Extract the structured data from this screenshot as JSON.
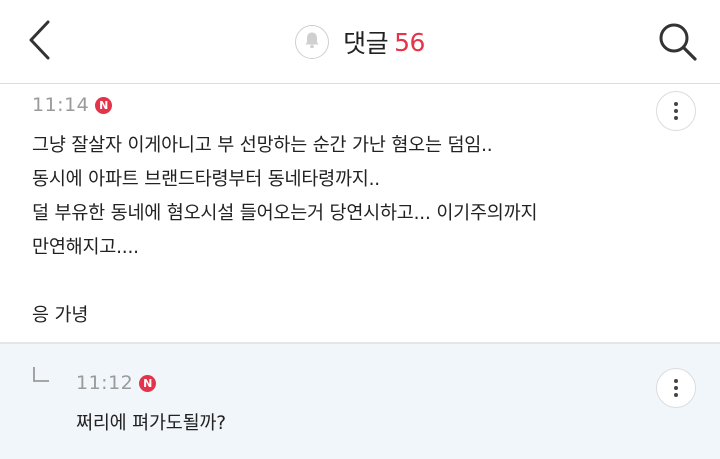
{
  "header": {
    "title": "댓글",
    "count": "56",
    "back_icon": "chevron-left-icon",
    "bell_icon": "bell-icon",
    "search_icon": "search-icon",
    "accent_color": "#e5334b"
  },
  "comments": [
    {
      "time": "11:14",
      "badge": "N",
      "lines": [
        "그냥 잘살자 이게아니고 부 선망하는 순간 가난 혐오는 덤임..",
        "동시에 아파트 브랜드타령부터 동네타령까지..",
        "덜 부유한 동네에 혐오시설 들어오는거 당연시하고... 이기주의까지",
        "만연해지고....",
        "",
        "응 가녕"
      ]
    }
  ],
  "reply": {
    "time": "11:12",
    "badge": "N",
    "text": "쩌리에 펴가도될까?",
    "background": "#f1f6fa"
  }
}
